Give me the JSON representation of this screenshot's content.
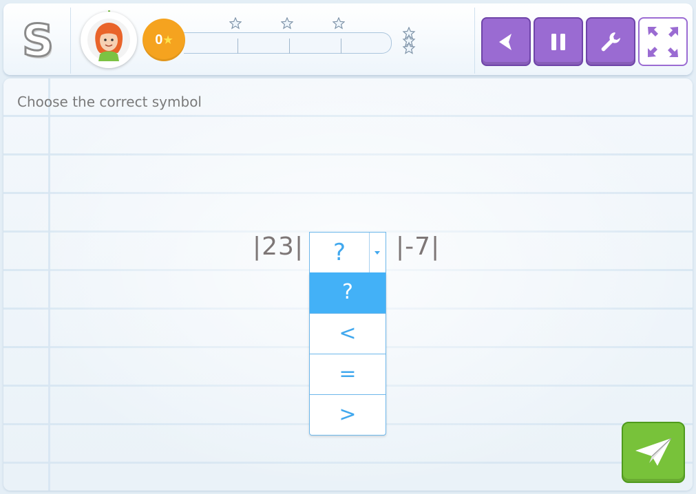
{
  "topbar": {
    "logo_letter": "S",
    "score": "0",
    "score_star": "★",
    "progress_stars": 3,
    "buttons": [
      {
        "name": "back-button",
        "icon": "chevron-left-icon"
      },
      {
        "name": "pause-button",
        "icon": "pause-icon"
      },
      {
        "name": "settings-button",
        "icon": "wrench-icon"
      },
      {
        "name": "fullscreen-button",
        "icon": "expand-arrows-icon"
      }
    ]
  },
  "question": {
    "instruction": "Choose the correct symbol",
    "left_expr": "|23|",
    "right_expr": "|-7|",
    "selected": "?",
    "options": [
      "?",
      "<",
      "=",
      ">"
    ]
  },
  "colors": {
    "accent_purple": "#9a6bd2",
    "submit_green": "#78c23a",
    "select_blue": "#43b1f7",
    "score_orange": "#f5a31f"
  }
}
